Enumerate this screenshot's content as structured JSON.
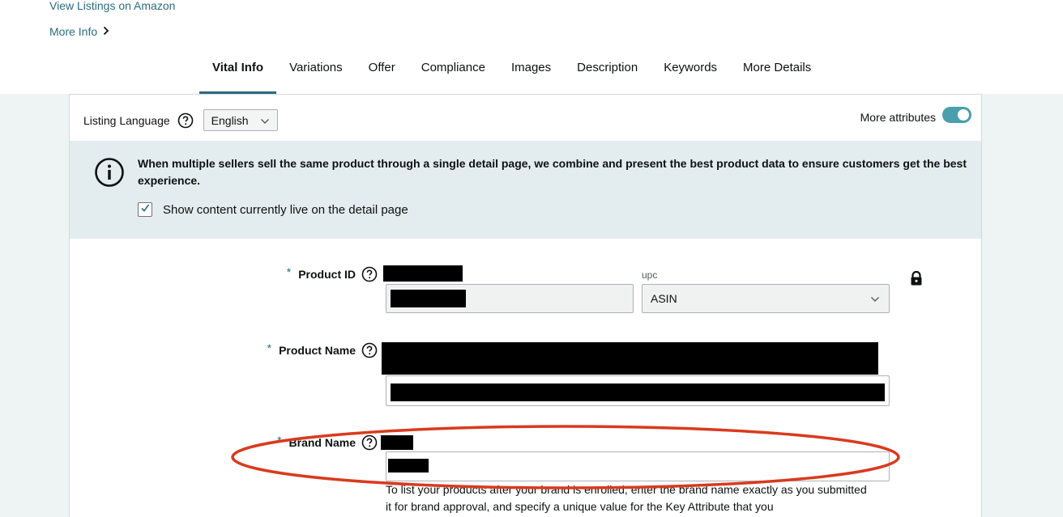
{
  "links": {
    "view_listings": "View Listings on Amazon",
    "more_info": "More Info"
  },
  "tabs": [
    {
      "label": "Vital Info",
      "active": true
    },
    {
      "label": "Variations"
    },
    {
      "label": "Offer"
    },
    {
      "label": "Compliance"
    },
    {
      "label": "Images"
    },
    {
      "label": "Description"
    },
    {
      "label": "Keywords"
    },
    {
      "label": "More Details"
    }
  ],
  "listing_language": {
    "label": "Listing Language",
    "value": "English"
  },
  "more_attributes": {
    "label": "More attributes",
    "enabled": true
  },
  "info_banner": {
    "text": "When multiple sellers sell the same product through a single detail page, we combine and present the best product data to ensure customers get the best experience.",
    "checkbox_label": "Show content currently live on the detail page",
    "checkbox_checked": true
  },
  "fields": {
    "product_id": {
      "label": "Product ID",
      "required_mark": "*",
      "id_type_caption": "upc",
      "id_type_value": "ASIN"
    },
    "product_name": {
      "label": "Product Name",
      "required_mark": "*"
    },
    "brand_name": {
      "label": "Brand Name",
      "required_mark": "*",
      "helper_text": "To list your products after your brand is enrolled, enter the brand name exactly as you submitted it for brand approval, and specify a unique value for the Key Attribute that you"
    }
  },
  "colors": {
    "accent": "#2b6c7e",
    "toggle_on": "#4a9eae",
    "banner_bg": "#e3ecee",
    "annotation_ellipse": "#d93a1e"
  }
}
